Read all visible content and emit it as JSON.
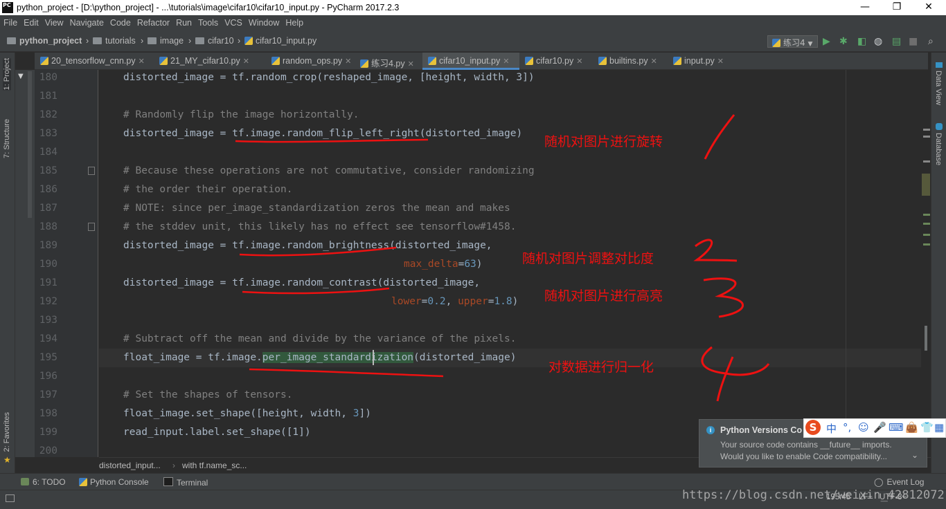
{
  "window": {
    "logo": "PC",
    "title": "python_project - [D:\\python_project] - ...\\tutorials\\image\\cifar10\\cifar10_input.py - PyCharm 2017.2.3",
    "minimize": "—",
    "restore": "❐",
    "close": "✕"
  },
  "menu": [
    "File",
    "Edit",
    "View",
    "Navigate",
    "Code",
    "Refactor",
    "Run",
    "Tools",
    "VCS",
    "Window",
    "Help"
  ],
  "breadcrumb": [
    "python_project",
    "tutorials",
    "image",
    "cifar10",
    "cifar10_input.py"
  ],
  "run_config": "练习4",
  "tabs": [
    {
      "label": "20_tensorflow_cnn.py",
      "active": false
    },
    {
      "label": "21_MY_cifar10.py",
      "active": false
    },
    {
      "label": "random_ops.py",
      "active": false
    },
    {
      "label": "练习4.py",
      "active": false
    },
    {
      "label": "cifar10_input.py",
      "active": true
    },
    {
      "label": "cifar10.py",
      "active": false
    },
    {
      "label": "builtins.py",
      "active": false
    },
    {
      "label": "input.py",
      "active": false
    }
  ],
  "left_tools": {
    "project": "1: Project",
    "structure": "7: Structure",
    "favorites": "2: Favorites"
  },
  "right_tools": {
    "data_view": "Data View",
    "database": "Database"
  },
  "line_numbers": [
    "180",
    "181",
    "182",
    "183",
    "184",
    "185",
    "186",
    "187",
    "188",
    "189",
    "190",
    "191",
    "192",
    "193",
    "194",
    "195",
    "196",
    "197",
    "198",
    "199",
    "200"
  ],
  "code": {
    "l180": "distorted_image = tf.random_crop(reshaped_image, [height, width, 3])",
    "l182": "# Randomly flip the image horizontally.",
    "l183a": "distorted_image = ",
    "l183b": "tf.image.random_flip_left_right",
    "l183c": "(distorted_image)",
    "l185": "# Because these operations are not commutative, consider randomizing",
    "l186": "# the order their operation.",
    "l187": "# NOTE: since per_image_standardization zeros the mean and makes",
    "l188": "# the stddev unit, this likely has no effect see tensorflow#1458.",
    "l189a": "distorted_image = ",
    "l189b": "tf.image.random_brightness",
    "l189c": "(distorted_image,",
    "l190a": "max_delta",
    "l190b": "=",
    "l190c": "63",
    "l190d": ")",
    "l191a": "distorted_image = ",
    "l191b": "tf.image.random_contrast",
    "l191c": "(distorted_image,",
    "l192a": "lower",
    "l192b": "=",
    "l192c": "0.2",
    "l192d": ", ",
    "l192e": "upper",
    "l192f": "=",
    "l192g": "1.8",
    "l192h": ")",
    "l194": "# Subtract off the mean and divide by the variance of the pixels.",
    "l195a": "float_image = tf.image.",
    "l195b": "per_image_standardization",
    "l195c": "(distorted_image)",
    "l197": "# Set the shapes of tensors.",
    "l198a": "float_image.set_shape([height, width, ",
    "l198b": "3",
    "l198c": "])",
    "l199": "read_input.label.set_shape([1])"
  },
  "annotations": {
    "a1": "随机对图片进行旋转",
    "a2": "随机对图片调整对比度",
    "a3": "随机对图片进行高亮",
    "a4": "对数据进行归一化"
  },
  "editor_breadcrumb": [
    "distorted_input...",
    "with tf.name_sc..."
  ],
  "bottom_tools": [
    "6: TODO",
    "Python Console",
    "Terminal"
  ],
  "event_log": "Event Log",
  "status": {
    "position": "195:45",
    "line_sep": "LF÷",
    "encoding": "UTF-8÷"
  },
  "notification": {
    "title": "Python Versions Co",
    "line1": "Your source code contains __future__ imports.",
    "line2": "Would you like to enable Code compatibility..."
  },
  "ime": [
    "S",
    "中",
    "°,",
    "☺",
    "🎤",
    "⌨",
    "👜",
    "👕",
    "▦"
  ],
  "watermark": "https://blog.csdn.net/weixin_42812072",
  "colors": {
    "accent": "#4a88c7",
    "annotation": "#ee1111",
    "comment": "#808080",
    "number": "#6897bb",
    "param": "#aa4926"
  }
}
